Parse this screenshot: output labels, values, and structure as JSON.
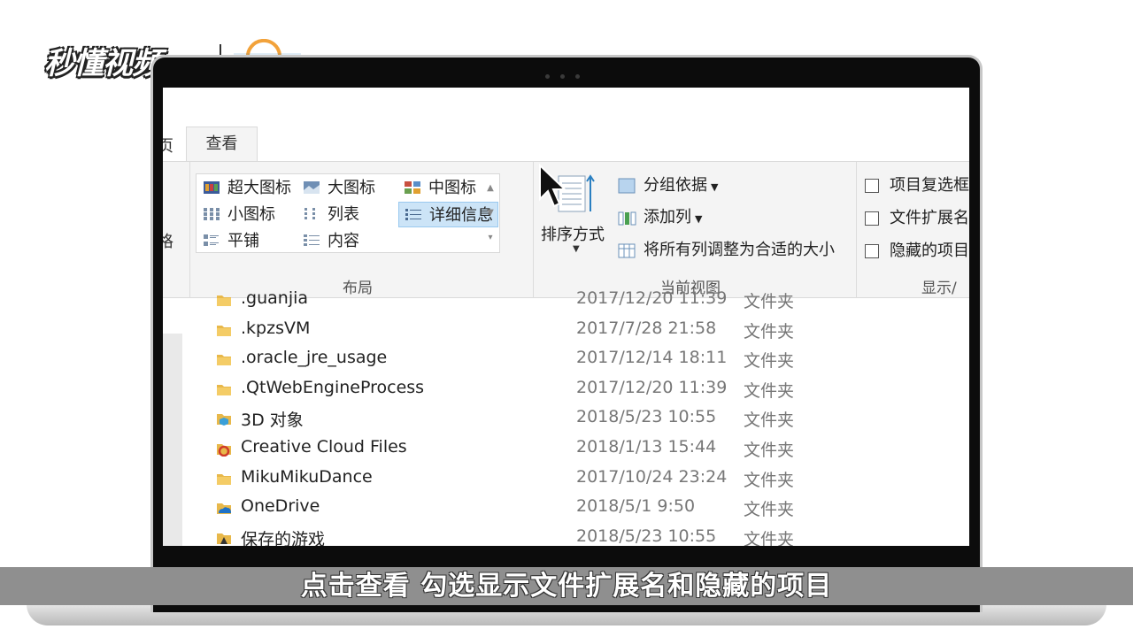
{
  "logo": {
    "brand": "秒懂视频"
  },
  "ribbon": {
    "tab_partial": "页",
    "tab_view": "查看",
    "left_partial": "格",
    "layout": {
      "group_label": "布局",
      "items": [
        {
          "label": "超大图标",
          "icon": "extra-large-icons-icon"
        },
        {
          "label": "大图标",
          "icon": "large-icons-icon"
        },
        {
          "label": "中图标",
          "icon": "medium-icons-icon"
        },
        {
          "label": "小图标",
          "icon": "small-icons-icon"
        },
        {
          "label": "列表",
          "icon": "list-icon"
        },
        {
          "label": "详细信息",
          "icon": "details-icon",
          "selected": true
        },
        {
          "label": "平铺",
          "icon": "tiles-icon"
        },
        {
          "label": "内容",
          "icon": "content-icon"
        }
      ]
    },
    "current_view": {
      "group_label": "当前视图",
      "sort_label": "排序方式",
      "group_by": "分组依据",
      "add_column": "添加列",
      "fit_columns": "将所有列调整为合适的大小"
    },
    "show_hide": {
      "group_label": "显示/隐",
      "item_checkboxes": "项目复选框",
      "file_extensions": "文件扩展名",
      "hidden_items": "隐藏的项目"
    }
  },
  "files": [
    {
      "name": ".guanjia",
      "date": "2017/12/20 11:39",
      "type": "文件夹",
      "icon": "folder-icon"
    },
    {
      "name": ".kpzsVM",
      "date": "2017/7/28 21:58",
      "type": "文件夹",
      "icon": "folder-icon"
    },
    {
      "name": ".oracle_jre_usage",
      "date": "2017/12/14 18:11",
      "type": "文件夹",
      "icon": "folder-icon"
    },
    {
      "name": ".QtWebEngineProcess",
      "date": "2017/12/20 11:39",
      "type": "文件夹",
      "icon": "folder-icon"
    },
    {
      "name": "3D 对象",
      "date": "2018/5/23 10:55",
      "type": "文件夹",
      "icon": "3d-objects-folder-icon"
    },
    {
      "name": "Creative Cloud Files",
      "date": "2018/1/13 15:44",
      "type": "文件夹",
      "icon": "creative-cloud-folder-icon"
    },
    {
      "name": "MikuMikuDance",
      "date": "2017/10/24 23:24",
      "type": "文件夹",
      "icon": "folder-icon"
    },
    {
      "name": "OneDrive",
      "date": "2018/5/1 9:50",
      "type": "文件夹",
      "icon": "onedrive-folder-icon"
    },
    {
      "name": "保存的游戏",
      "date": "2018/5/23 10:55",
      "type": "文件夹",
      "icon": "saved-games-folder-icon"
    }
  ],
  "caption": "点击查看 勾选显示文件扩展名和隐藏的项目",
  "colors": {
    "ribbon_bg": "#f4f4f4",
    "selection": "#cce4f7",
    "folder": "#e8b84a",
    "caption_bar": "#8f8f8f"
  }
}
